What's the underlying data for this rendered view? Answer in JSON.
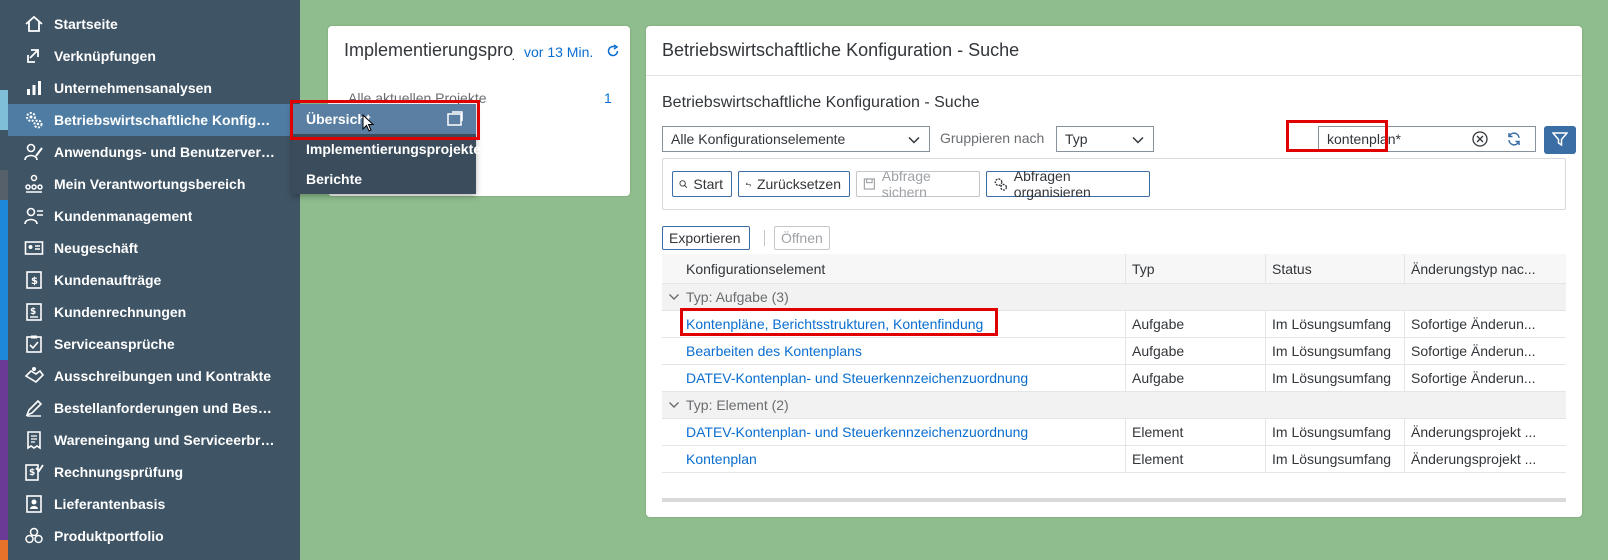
{
  "nav": {
    "items": [
      {
        "label": "Startseite",
        "icon": "home-icon"
      },
      {
        "label": "Verknüpfungen",
        "icon": "link-icon"
      },
      {
        "label": "Unternehmensanalysen",
        "icon": "bar-chart-icon"
      },
      {
        "label": "Betriebswirtschaftliche Konfigurati...",
        "icon": "gears-icon",
        "active": true
      },
      {
        "label": "Anwendungs- und Benutzerverwa...",
        "icon": "user-edit-icon"
      },
      {
        "label": "Mein Verantwortungsbereich",
        "icon": "org-chart-icon"
      },
      {
        "label": "Kundenmanagement",
        "icon": "customer-icon"
      },
      {
        "label": "Neugeschäft",
        "icon": "id-card-icon"
      },
      {
        "label": "Kundenaufträge",
        "icon": "sales-order-icon"
      },
      {
        "label": "Kundenrechnungen",
        "icon": "invoice-icon"
      },
      {
        "label": "Serviceansprüche",
        "icon": "clipboard-icon"
      },
      {
        "label": "Ausschreibungen und Kontrakte",
        "icon": "handshake-icon"
      },
      {
        "label": "Bestellanforderungen und Bestell...",
        "icon": "pen-icon"
      },
      {
        "label": "Wareneingang und Serviceerbring...",
        "icon": "receipt-icon"
      },
      {
        "label": "Rechnungsprüfung",
        "icon": "invoice-check-icon"
      },
      {
        "label": "Lieferantenbasis",
        "icon": "supplier-icon"
      },
      {
        "label": "Produktportfolio",
        "icon": "cubes-icon"
      }
    ],
    "strip_colors": [
      "#3f5465",
      "#7fbfd8",
      "#3f5465",
      "#1e88d8",
      "#1e6fc8",
      "#6b3a96",
      "#e8722a"
    ]
  },
  "flyout": {
    "items": [
      "Übersicht",
      "Implementierungsprojekte",
      "Berichte"
    ]
  },
  "card1": {
    "title": "Implementierungsprojekte",
    "ago": "vor 13 Min.",
    "row_label": "Alle aktuellen Projekte",
    "row_count": "1"
  },
  "card2": {
    "title": "Betriebswirtschaftliche Konfiguration - Suche",
    "subtitle": "Betriebswirtschaftliche Konfiguration - Suche",
    "scope_select": "Alle Konfigurationselemente",
    "group_label": "Gruppieren nach",
    "group_select": "Typ",
    "search_value": "kontenplan*",
    "buttons": {
      "start": "Start",
      "reset": "Zurücksetzen",
      "save_query": "Abfrage sichern",
      "organize": "Abfragen organisieren",
      "export": "Exportieren",
      "open": "Öffnen"
    },
    "columns": [
      "Konfigurationselement",
      "Typ",
      "Status",
      "Änderungstyp nac..."
    ],
    "groups": [
      {
        "label": "Typ: Aufgabe (3)",
        "rows": [
          {
            "element": "Kontenpläne, Berichtsstrukturen, Kontenfindung",
            "type": "Aufgabe",
            "status": "Im Lösungsumfang",
            "change": "Sofortige Änderun..."
          },
          {
            "element": "Bearbeiten des Kontenplans",
            "type": "Aufgabe",
            "status": "Im Lösungsumfang",
            "change": "Sofortige Änderun..."
          },
          {
            "element": "DATEV-Kontenplan- und Steuerkennzeichenzuordnung",
            "type": "Aufgabe",
            "status": "Im Lösungsumfang",
            "change": "Sofortige Änderun..."
          }
        ]
      },
      {
        "label": "Typ: Element (2)",
        "rows": [
          {
            "element": "DATEV-Kontenplan- und Steuerkennzeichenzuordnung",
            "type": "Element",
            "status": "Im Lösungsumfang",
            "change": "Änderungsprojekt ..."
          },
          {
            "element": "Kontenplan",
            "type": "Element",
            "status": "Im Lösungsumfang",
            "change": "Änderungsprojekt ..."
          }
        ]
      }
    ]
  },
  "colors": {
    "background": "#8fbd8d",
    "nav": "#3f5465",
    "nav_active": "#4f7ca3",
    "link": "#0a6ed1",
    "highlight": "#e00000"
  }
}
